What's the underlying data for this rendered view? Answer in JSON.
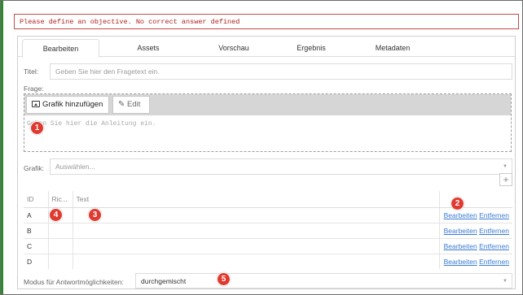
{
  "error": {
    "message": "Please define an objective. No correct answer defined"
  },
  "tabs": [
    "Bearbeiten",
    "Assets",
    "Vorschau",
    "Ergebnis",
    "Metadaten"
  ],
  "title_field": {
    "label": "Titel:",
    "placeholder": "Geben Sie hier den Fragetext ein."
  },
  "question": {
    "label": "Frage:",
    "add_graphic": "Grafik hinzufügen",
    "edit": "Edit",
    "hint": "Geben Sie hier die Anleitung ein."
  },
  "graphic_field": {
    "label": "Grafik:",
    "placeholder": "Auswählen..."
  },
  "add_button": "+",
  "answers": {
    "headers": [
      "ID",
      "Ric...",
      "Text",
      ""
    ],
    "rows": [
      {
        "id": "A",
        "edit": "Bearbeiten",
        "remove": "Entfernen"
      },
      {
        "id": "B",
        "edit": "Bearbeiten",
        "remove": "Entfernen"
      },
      {
        "id": "C",
        "edit": "Bearbeiten",
        "remove": "Entfernen"
      },
      {
        "id": "D",
        "edit": "Bearbeiten",
        "remove": "Entfernen"
      }
    ]
  },
  "mode": {
    "label": "Modus für Antwortmöglichkeiten:",
    "value": "durchgemischt"
  },
  "markers": [
    "1",
    "2",
    "3",
    "4",
    "5"
  ],
  "colors": {
    "error": "#b02020",
    "link": "#3a7bd5",
    "marker": "#e03a30"
  }
}
